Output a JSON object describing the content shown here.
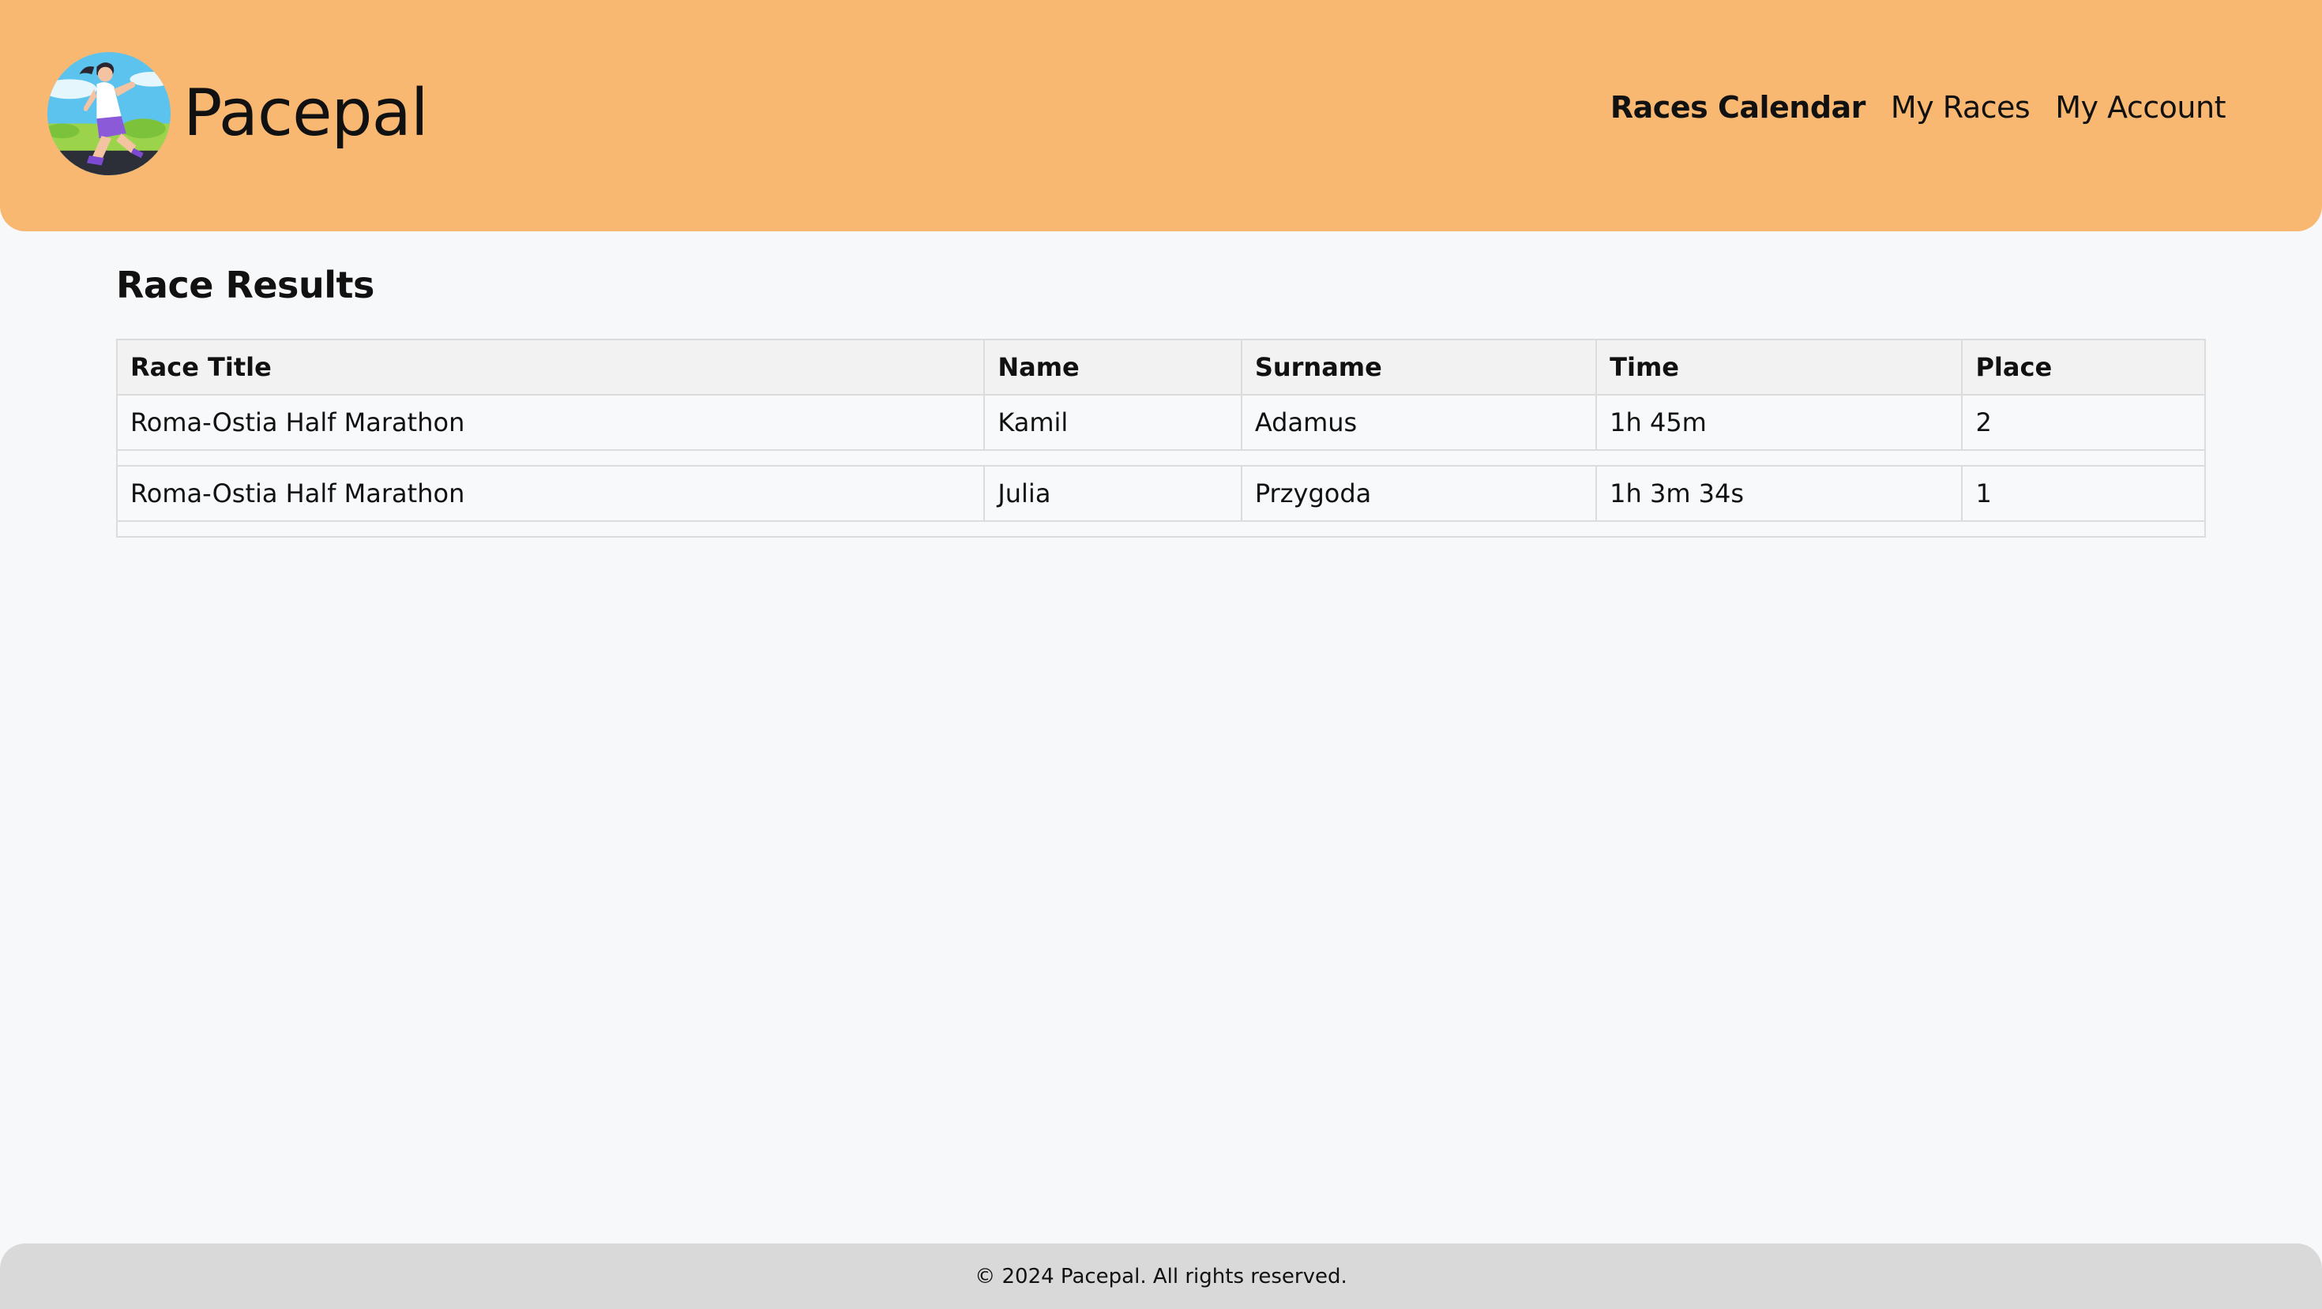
{
  "app": {
    "name": "Pacepal"
  },
  "nav": {
    "items": [
      {
        "label": "Races Calendar",
        "active": true
      },
      {
        "label": "My Races",
        "active": false
      },
      {
        "label": "My Account",
        "active": false
      }
    ]
  },
  "page": {
    "title": "Race Results"
  },
  "table": {
    "headers": [
      "Race Title",
      "Name",
      "Surname",
      "Time",
      "Place"
    ],
    "rows": [
      [
        "Roma-Ostia Half Marathon",
        "Kamil",
        "Adamus",
        "1h 45m",
        "2"
      ],
      [
        "Roma-Ostia Half Marathon",
        "Julia",
        "Przygoda",
        "1h 3m 34s",
        "1"
      ]
    ]
  },
  "footer": {
    "text": "© 2024 Pacepal. All rights reserved."
  },
  "icons": {
    "logo": "runner-logo-icon"
  },
  "colors": {
    "header_bg": "#f8b872",
    "page_bg": "#f6f8fa",
    "footer_bg": "#d9d9d9",
    "table_header_bg": "#f2f2f2",
    "table_border": "#dcdcdc"
  }
}
